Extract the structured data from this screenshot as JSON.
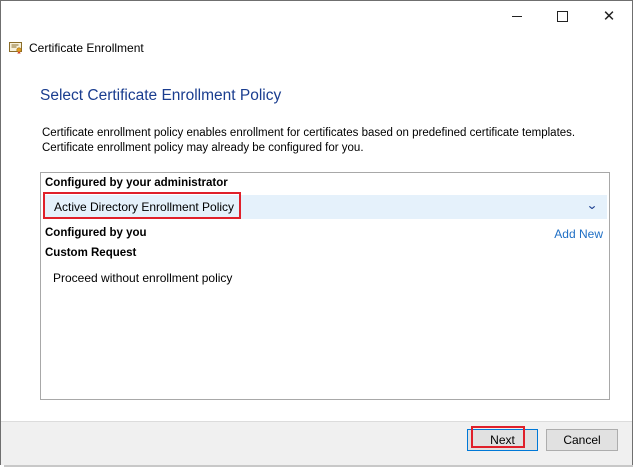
{
  "window": {
    "title": "Certificate Enrollment",
    "controls": [
      "minimize",
      "maximize",
      "close"
    ]
  },
  "page": {
    "heading": "Select Certificate Enrollment Policy",
    "description": "Certificate enrollment policy enables enrollment for certificates based on predefined certificate templates. Certificate enrollment policy may already be configured for you."
  },
  "policy_list": {
    "group_admin": "Configured by your administrator",
    "admin_policy": "Active Directory Enrollment Policy",
    "group_you": "Configured by you",
    "add_new": "Add New",
    "group_custom": "Custom Request",
    "custom_option": "Proceed without enrollment policy"
  },
  "buttons": {
    "next": "Next",
    "cancel": "Cancel"
  },
  "colors": {
    "heading": "#1a3d8f",
    "link": "#1f6fc5",
    "selected_row": "#e5f1fb",
    "annotation": "#e0202a"
  }
}
